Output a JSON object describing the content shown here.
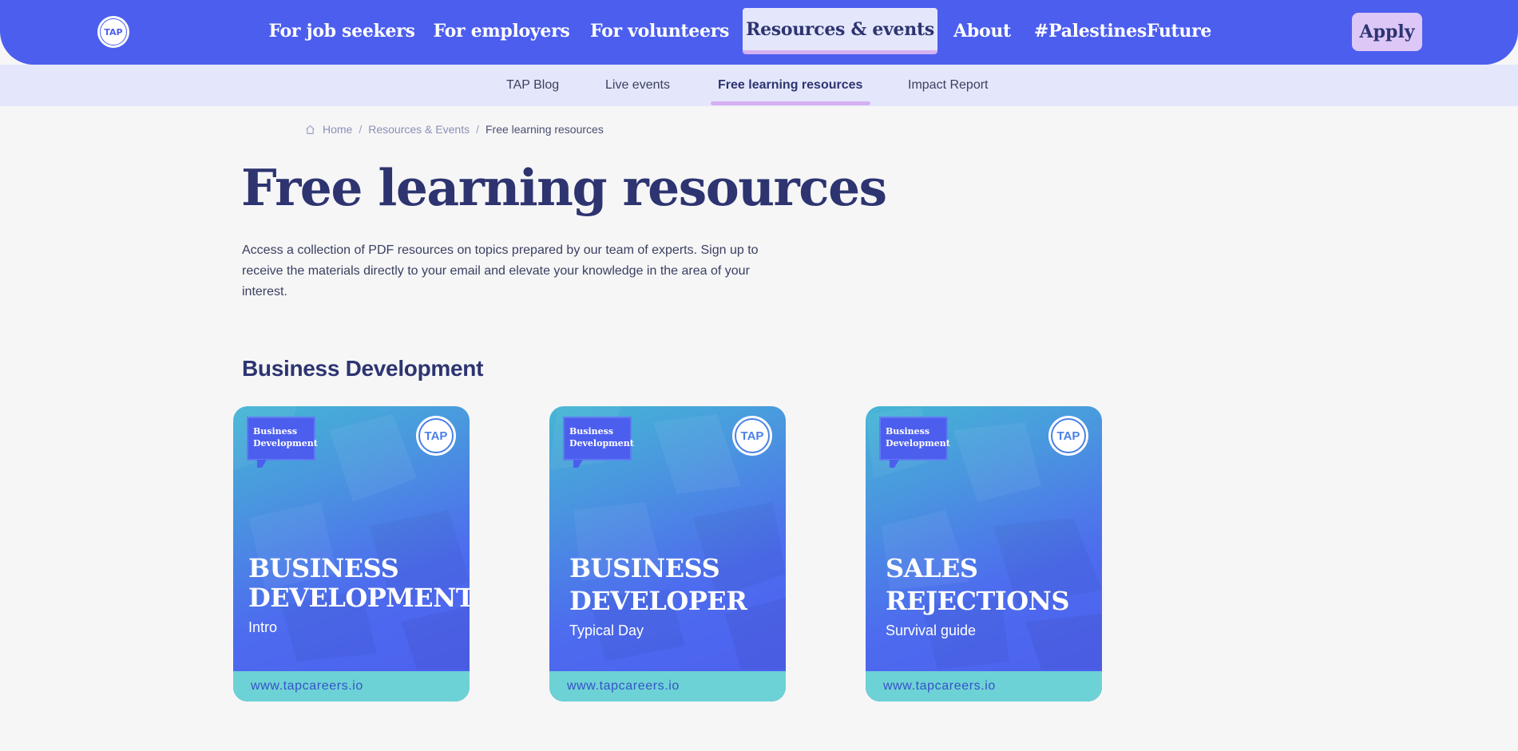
{
  "header": {
    "logo_text": "TAP",
    "nav": [
      {
        "label": "For job seekers"
      },
      {
        "label": "For employers"
      },
      {
        "label": "For volunteers"
      },
      {
        "label": "Resources & events"
      },
      {
        "label": "About"
      },
      {
        "label": "#PalestinesFuture"
      }
    ],
    "apply_label": "Apply"
  },
  "subnav": [
    {
      "label": "TAP Blog"
    },
    {
      "label": "Live events"
    },
    {
      "label": "Free learning resources"
    },
    {
      "label": "Impact Report"
    }
  ],
  "breadcrumb": {
    "home": "Home",
    "section": "Resources & Events",
    "current": "Free learning resources",
    "separator": "/"
  },
  "page": {
    "title": "Free learning resources",
    "intro": "Access a collection of PDF resources on topics prepared by our team of experts. Sign up to receive the materials directly to your email and elevate your knowledge in the area of your interest.",
    "section_title": "Business Development"
  },
  "cards": [
    {
      "tag_line1": "Business",
      "tag_line2": "Development",
      "badge": "TAP",
      "headline1": "BUSINESS",
      "headline2": "DEVELOPMENT",
      "subline": "Intro",
      "footer": "www.tapcareers.io"
    },
    {
      "tag_line1": "Business",
      "tag_line2": "Development",
      "badge": "TAP",
      "headline1": "BUSINESS",
      "headline2": "DEVELOPER",
      "subline": "Typical Day",
      "footer": "www.tapcareers.io"
    },
    {
      "tag_line1": "Business",
      "tag_line2": "Development",
      "badge": "TAP",
      "headline1": "SALES",
      "headline2": "REJECTIONS",
      "subline": "Survival guide",
      "footer": "www.tapcareers.io"
    }
  ],
  "colors": {
    "primary": "#4c5eee",
    "subnav_bg": "#e4e7fc",
    "accent": "#d5b0f2",
    "apply_bg": "#dcc7f7",
    "heading": "#2d3470",
    "card_footer": "#6dd2d5"
  }
}
